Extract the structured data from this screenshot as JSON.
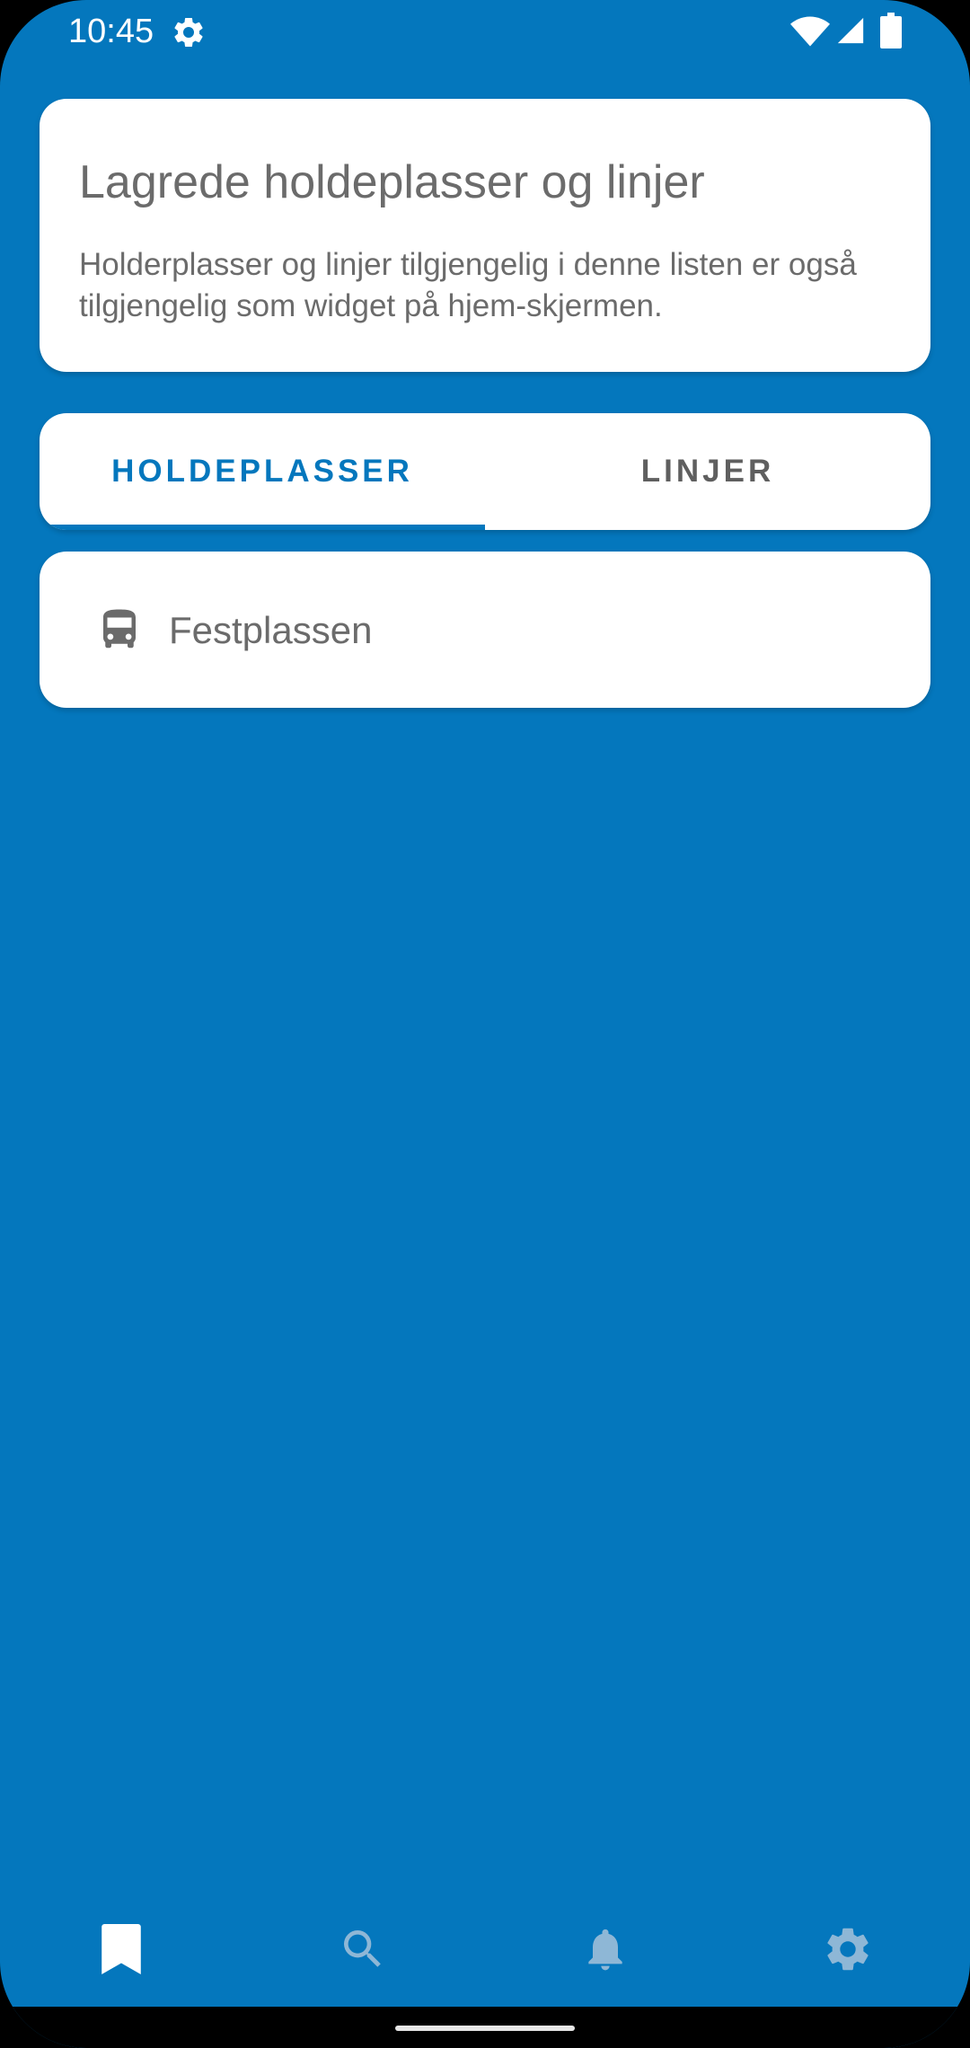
{
  "status_bar": {
    "time": "10:45",
    "icons": [
      "gear-icon",
      "wifi-icon",
      "signal-icon",
      "battery-icon"
    ]
  },
  "info_card": {
    "title": "Lagrede holdeplasser og linjer",
    "body": "Holderplasser og linjer tilgjengelig i denne listen er også tilgjengelig som widget på hjem-skjermen."
  },
  "tabs": {
    "items": [
      {
        "label": "HOLDEPLASSER",
        "selected": true
      },
      {
        "label": "LINJER",
        "selected": false
      }
    ]
  },
  "saved_stops": [
    {
      "icon": "bus-icon",
      "name": "Festplassen"
    }
  ],
  "bottom_nav": {
    "items": [
      {
        "icon": "bookmark-icon",
        "active": true
      },
      {
        "icon": "search-icon",
        "active": false
      },
      {
        "icon": "bell-icon",
        "active": false
      },
      {
        "icon": "gear-icon",
        "active": false
      }
    ]
  },
  "colors": {
    "primary": "#0477BD",
    "card": "#FFFFFF",
    "text_secondary": "#6B6B6B",
    "nav_active": "#FFFFFF",
    "nav_inactive": "#8EB7D6"
  }
}
